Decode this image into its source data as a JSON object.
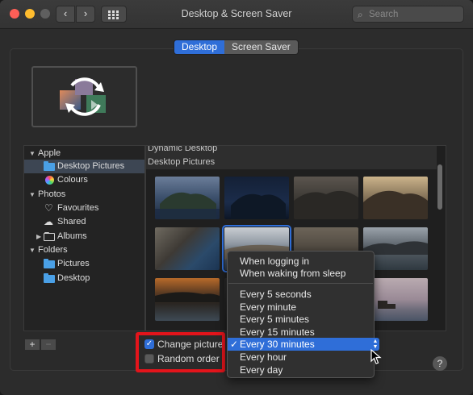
{
  "window": {
    "title": "Desktop & Screen Saver",
    "nav_back_icon": "‹",
    "nav_forward_icon": "›",
    "help_label": "?"
  },
  "search": {
    "placeholder": "Search"
  },
  "tabs": [
    {
      "label": "Desktop",
      "active": true
    },
    {
      "label": "Screen Saver",
      "active": false
    }
  ],
  "sidebar": {
    "items": [
      {
        "label": "Apple",
        "kind": "group",
        "icon": "disclosure-down-icon"
      },
      {
        "label": "Desktop Pictures",
        "kind": "folder",
        "icon": "folder-icon",
        "selected": true
      },
      {
        "label": "Colours",
        "kind": "item",
        "icon": "colour-wheel-icon"
      },
      {
        "label": "Photos",
        "kind": "group",
        "icon": "disclosure-down-icon"
      },
      {
        "label": "Favourites",
        "kind": "item",
        "icon": "heart-icon"
      },
      {
        "label": "Shared",
        "kind": "item",
        "icon": "cloud-icon"
      },
      {
        "label": "Albums",
        "kind": "folder-outline",
        "icon": "folder-icon"
      },
      {
        "label": "Folders",
        "kind": "group",
        "icon": "disclosure-down-icon"
      },
      {
        "label": "Pictures",
        "kind": "folder",
        "icon": "folder-icon"
      },
      {
        "label": "Desktop",
        "kind": "folder",
        "icon": "folder-icon"
      }
    ],
    "add_label": "+",
    "remove_label": "−"
  },
  "gallery": {
    "groups": [
      {
        "title": "Dynamic Desktop"
      },
      {
        "title": "Desktop Pictures"
      }
    ]
  },
  "options": {
    "change_picture": {
      "label": "Change picture:",
      "checked": true
    },
    "random_order": {
      "label": "Random order",
      "checked": false
    }
  },
  "interval_menu": {
    "selected": "Every 30 minutes",
    "items": [
      {
        "label": "When logging in"
      },
      {
        "label": "When waking from sleep"
      },
      {
        "label": "Every 5 seconds"
      },
      {
        "label": "Every minute"
      },
      {
        "label": "Every 5 minutes"
      },
      {
        "label": "Every 15 minutes"
      },
      {
        "label": "Every 30 minutes",
        "checked": true
      },
      {
        "label": "Every hour"
      },
      {
        "label": "Every day"
      }
    ],
    "check_mark": "✓"
  },
  "colors": {
    "accent": "#2f6ed8",
    "highlight_box": "#e3141b",
    "window_bg": "#2c2c2c"
  }
}
